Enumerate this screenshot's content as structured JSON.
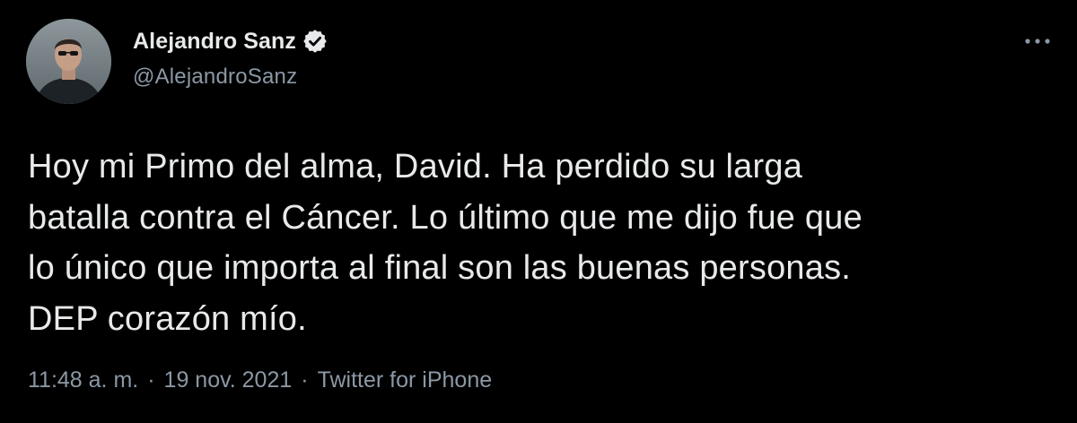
{
  "author": {
    "display_name": "Alejandro Sanz",
    "handle": "@AlejandroSanz",
    "verified": true,
    "avatar": "profile-photo"
  },
  "tweet": {
    "text": "Hoy mi Primo del alma, David. Ha perdido su larga\nbatalla contra el Cáncer. Lo último que me dijo fue que\nlo único que importa al final son las buenas personas.\nDEP corazón mío.",
    "time": "11:48 a. m.",
    "date": "19 nov. 2021",
    "source": "Twitter for iPhone",
    "separator": "·"
  },
  "icons": {
    "verified": "verified-badge-icon",
    "more": "more-options-icon"
  },
  "colors": {
    "background": "#000000",
    "primary_text": "#e7e9ea",
    "secondary_text": "#8b98a5"
  }
}
